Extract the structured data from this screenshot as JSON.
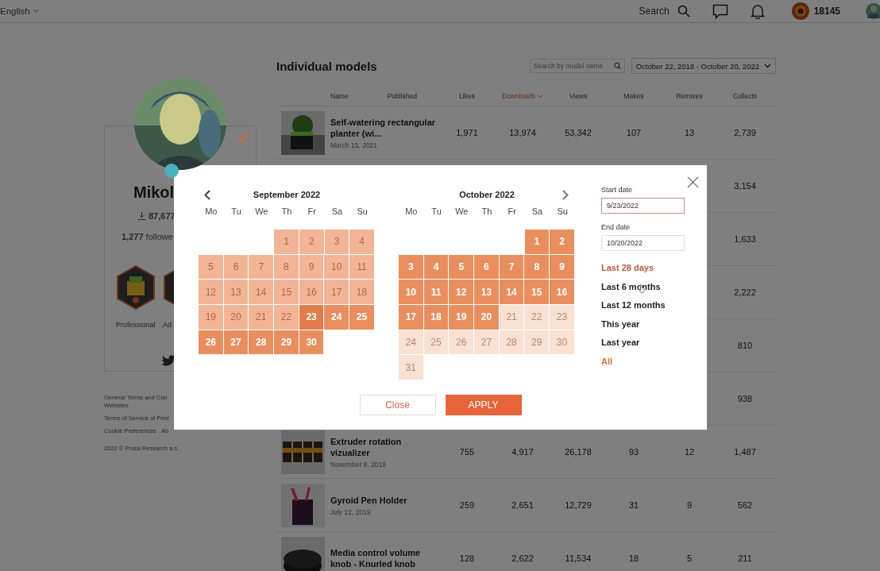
{
  "topbar": {
    "language": "English",
    "search_label": "Search",
    "points": "18145"
  },
  "profile": {
    "name": "Mikol",
    "downloads": "87,677",
    "followers": "**1,277** followe",
    "badges": [
      {
        "label": "Professional"
      },
      {
        "label": "Ad"
      }
    ]
  },
  "footer": {
    "lines": [
      {
        "links": [
          "General Terms and Con"
        ]
      },
      {
        "links": [
          "Websites"
        ]
      },
      {
        "links": [
          "Terms of Service of Print"
        ]
      },
      {
        "links": [
          "Cookie Preferences",
          "Ab"
        ]
      }
    ],
    "copyright": "2022 © Prusa Research a.s."
  },
  "models": {
    "title": "Individual models",
    "search": {
      "placeholder": "Search by model name"
    },
    "date_range": "October 22, 2018 - October 20, 2022",
    "columns": [
      {
        "label": "Name",
        "sorted": false
      },
      {
        "label": "Published",
        "sorted": false
      },
      {
        "label": "Likes",
        "sorted": false
      },
      {
        "label": "Downloads",
        "sorted": true
      },
      {
        "label": "Views",
        "sorted": false
      },
      {
        "label": "Makes",
        "sorted": false
      },
      {
        "label": "Remixes",
        "sorted": false
      },
      {
        "label": "Collects",
        "sorted": false
      }
    ],
    "rows": [
      {
        "name": "Self-watering rectangular planter (wi...",
        "date": "March 15, 2021",
        "likes": "1,971",
        "downloads": "13,974",
        "views": "53,342",
        "makes": "107",
        "remixes": "13",
        "collects": "2,739"
      },
      {
        "collects": "3,154"
      },
      {
        "collects": "1,633"
      },
      {
        "collects": "2,222"
      },
      {
        "collects": "810"
      },
      {
        "collects": "938"
      },
      {
        "name": "Extruder rotation vizualizer",
        "date": "November 8, 2018",
        "likes": "755",
        "downloads": "4,917",
        "views": "26,178",
        "makes": "93",
        "remixes": "12",
        "collects": "1,487"
      },
      {
        "name": "Gyroid Pen Holder",
        "date": "July 12, 2019",
        "likes": "259",
        "downloads": "2,651",
        "views": "12,729",
        "makes": "31",
        "remixes": "9",
        "collects": "562"
      },
      {
        "name": "Media control volume knob - Knurled knob",
        "likes": "128",
        "downloads": "2,622",
        "views": "11,534",
        "makes": "18",
        "remixes": "5",
        "collects": "211"
      }
    ]
  },
  "date_picker": {
    "months": [
      {
        "title": "September 2022",
        "weekdays": [
          "Mo",
          "Tu",
          "We",
          "Th",
          "Fr",
          "Sa",
          "Su"
        ],
        "weeks": [
          {
            "days": [
              {
                "day": "1",
                "selected": false,
                "edge": false,
                "disabled": false
              },
              {
                "day": "2",
                "selected": false,
                "edge": false,
                "disabled": false
              },
              {
                "day": "3",
                "selected": false,
                "edge": false,
                "disabled": false
              },
              {
                "day": "4",
                "selected": false,
                "edge": false,
                "disabled": false
              }
            ]
          },
          {
            "days": [
              {
                "day": "5",
                "selected": false,
                "edge": false,
                "disabled": false
              },
              {
                "day": "6",
                "selected": false,
                "edge": false,
                "disabled": false
              },
              {
                "day": "7",
                "selected": false,
                "edge": false,
                "disabled": false
              },
              {
                "day": "8",
                "selected": false,
                "edge": false,
                "disabled": false
              },
              {
                "day": "9",
                "selected": false,
                "edge": false,
                "disabled": false
              },
              {
                "day": "10",
                "selected": false,
                "edge": false,
                "disabled": false
              },
              {
                "day": "11",
                "selected": false,
                "edge": false,
                "disabled": false
              }
            ]
          },
          {
            "days": [
              {
                "day": "12",
                "selected": false,
                "edge": false,
                "disabled": false
              },
              {
                "day": "13",
                "selected": false,
                "edge": false,
                "disabled": false
              },
              {
                "day": "14",
                "selected": false,
                "edge": false,
                "disabled": false
              },
              {
                "day": "15",
                "selected": false,
                "edge": false,
                "disabled": false
              },
              {
                "day": "16",
                "selected": false,
                "edge": false,
                "disabled": false
              },
              {
                "day": "17",
                "selected": false,
                "edge": false,
                "disabled": false
              },
              {
                "day": "18",
                "selected": false,
                "edge": false,
                "disabled": false
              }
            ]
          },
          {
            "days": [
              {
                "day": "19",
                "selected": false,
                "edge": false,
                "disabled": false
              },
              {
                "day": "20",
                "selected": false,
                "edge": false,
                "disabled": false
              },
              {
                "day": "21",
                "selected": false,
                "edge": false,
                "disabled": false
              },
              {
                "day": "22",
                "selected": false,
                "edge": false,
                "disabled": false
              },
              {
                "day": "23",
                "selected": true,
                "edge": true,
                "disabled": false
              },
              {
                "day": "24",
                "selected": true,
                "edge": false,
                "disabled": false
              },
              {
                "day": "25",
                "selected": true,
                "edge": false,
                "disabled": false
              }
            ]
          },
          {
            "days": [
              {
                "day": "26",
                "selected": true,
                "edge": false,
                "disabled": false
              },
              {
                "day": "27",
                "selected": true,
                "edge": false,
                "disabled": false
              },
              {
                "day": "28",
                "selected": true,
                "edge": false,
                "disabled": false
              },
              {
                "day": "29",
                "selected": true,
                "edge": false,
                "disabled": false
              },
              {
                "day": "30",
                "selected": true,
                "edge": false,
                "disabled": false
              }
            ]
          }
        ]
      },
      {
        "title": "October 2022",
        "weekdays": [
          "Mo",
          "Tu",
          "We",
          "Th",
          "Fr",
          "Sa",
          "Su"
        ],
        "weeks": [
          {
            "days": [
              {
                "day": "1",
                "selected": true,
                "edge": false,
                "disabled": false
              },
              {
                "day": "2",
                "selected": true,
                "edge": false,
                "disabled": false
              }
            ]
          },
          {
            "days": [
              {
                "day": "3",
                "selected": true,
                "edge": false,
                "disabled": false
              },
              {
                "day": "4",
                "selected": true,
                "edge": false,
                "disabled": false
              },
              {
                "day": "5",
                "selected": true,
                "edge": false,
                "disabled": false
              },
              {
                "day": "6",
                "selected": true,
                "edge": false,
                "disabled": false
              },
              {
                "day": "7",
                "selected": true,
                "edge": false,
                "disabled": false
              },
              {
                "day": "8",
                "selected": true,
                "edge": false,
                "disabled": false
              },
              {
                "day": "9",
                "selected": true,
                "edge": false,
                "disabled": false
              }
            ]
          },
          {
            "days": [
              {
                "day": "10",
                "selected": true,
                "edge": false,
                "disabled": false
              },
              {
                "day": "11",
                "selected": true,
                "edge": false,
                "disabled": false
              },
              {
                "day": "12",
                "selected": true,
                "edge": false,
                "disabled": false
              },
              {
                "day": "13",
                "selected": true,
                "edge": false,
                "disabled": false
              },
              {
                "day": "14",
                "selected": true,
                "edge": false,
                "disabled": false
              },
              {
                "day": "15",
                "selected": true,
                "edge": false,
                "disabled": false
              },
              {
                "day": "16",
                "selected": true,
                "edge": false,
                "disabled": false
              }
            ]
          },
          {
            "days": [
              {
                "day": "17",
                "selected": true,
                "edge": false,
                "disabled": false
              },
              {
                "day": "18",
                "selected": true,
                "edge": false,
                "disabled": false
              },
              {
                "day": "19",
                "selected": true,
                "edge": false,
                "disabled": false
              },
              {
                "day": "20",
                "selected": true,
                "edge": false,
                "disabled": false
              },
              {
                "day": "21",
                "selected": false,
                "edge": false,
                "disabled": true
              },
              {
                "day": "22",
                "selected": false,
                "edge": false,
                "disabled": true
              },
              {
                "day": "23",
                "selected": false,
                "edge": false,
                "disabled": true
              }
            ]
          },
          {
            "days": [
              {
                "day": "24",
                "selected": false,
                "edge": false,
                "disabled": true
              },
              {
                "day": "25",
                "selected": false,
                "edge": false,
                "disabled": true
              },
              {
                "day": "26",
                "selected": false,
                "edge": false,
                "disabled": true
              },
              {
                "day": "27",
                "selected": false,
                "edge": false,
                "disabled": true
              },
              {
                "day": "28",
                "selected": false,
                "edge": false,
                "disabled": true
              },
              {
                "day": "29",
                "selected": false,
                "edge": false,
                "disabled": true
              },
              {
                "day": "30",
                "selected": false,
                "edge": false,
                "disabled": true
              }
            ]
          },
          {
            "days": [
              {
                "day": "31",
                "selected": false,
                "edge": false,
                "disabled": true
              }
            ]
          }
        ]
      }
    ],
    "fields": [
      {
        "label": "Start date",
        "value": "9/23/2022",
        "focused": true
      },
      {
        "label": "End date",
        "value": "10/20/2022",
        "focused": false
      }
    ],
    "presets": [
      {
        "label": "Last 28 days",
        "selected": false,
        "hovered": true
      },
      {
        "label": "Last 6 months",
        "selected": false,
        "hovered": false
      },
      {
        "label": "Last 12 months",
        "selected": false,
        "hovered": false
      },
      {
        "label": "This year",
        "selected": false,
        "hovered": false
      },
      {
        "label": "Last year",
        "selected": false,
        "hovered": false
      },
      {
        "label": "All",
        "selected": true,
        "hovered": false
      }
    ],
    "buttons": [
      {
        "label": "Close",
        "kind": "secondary"
      },
      {
        "label": "APPLY",
        "kind": "primary"
      }
    ]
  }
}
